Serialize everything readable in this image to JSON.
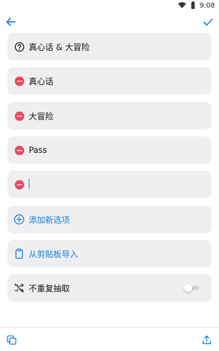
{
  "status_bar": {
    "time": "9:08",
    "wifi_icon": "wifi-icon",
    "battery_icon": "battery-icon"
  },
  "app_bar": {
    "back_icon": "arrow-left-icon",
    "confirm_icon": "check-icon"
  },
  "header_item": {
    "label": "真心话 & 大冒险",
    "icon": "help-circle-icon"
  },
  "options": [
    {
      "label": "真心话",
      "icon": "remove-circle-icon"
    },
    {
      "label": "大冒险",
      "icon": "remove-circle-icon"
    },
    {
      "label": "Pass",
      "icon": "remove-circle-icon"
    },
    {
      "label": "",
      "icon": "remove-circle-icon"
    }
  ],
  "actions": {
    "add_option": "添加新选项",
    "import_clipboard": "从剪贴板导入"
  },
  "settings": {
    "no_repeat": {
      "label": "不重复抽取",
      "enabled": false
    }
  },
  "bottom_bar": {
    "left_icon": "copy-icon",
    "right_icon": "share-icon"
  },
  "colors": {
    "accent": "#1a7fd9",
    "remove": "#f0465a",
    "card_bg": "#efeff2"
  }
}
